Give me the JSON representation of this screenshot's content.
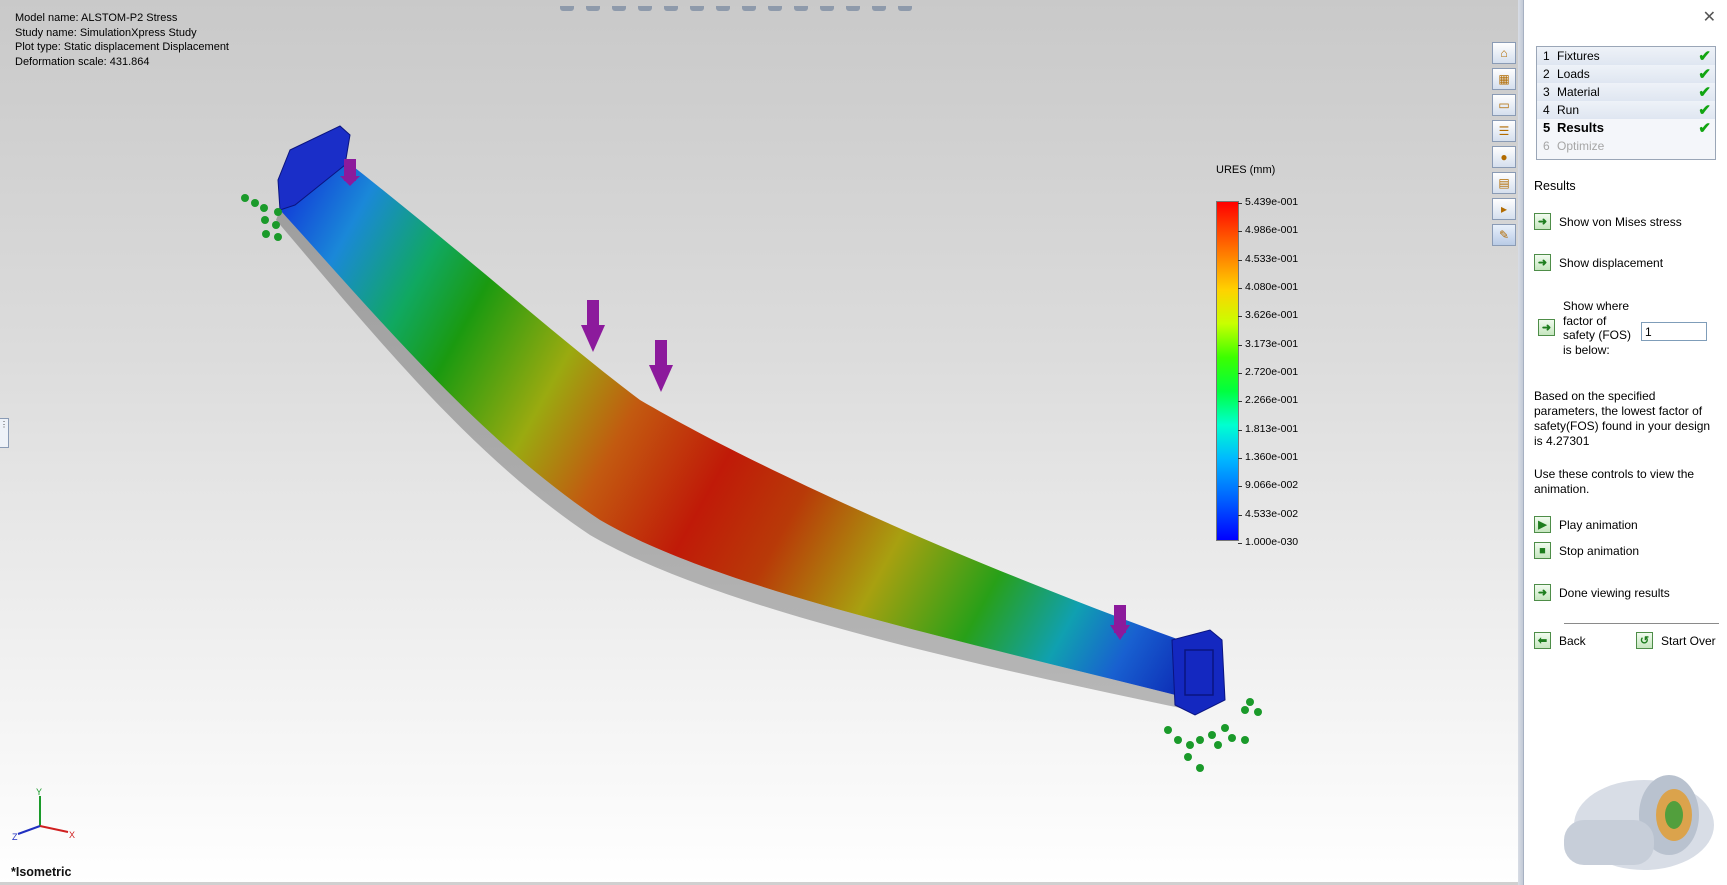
{
  "viewport": {
    "info": [
      "Model name: ALSTOM-P2 Stress",
      "Study name: SimulationXpress Study",
      "Plot type: Static displacement Displacement",
      "Deformation scale: 431.864"
    ],
    "legend": {
      "title": "URES (mm)",
      "ticks": [
        "5.439e-001",
        "4.986e-001",
        "4.533e-001",
        "4.080e-001",
        "3.626e-001",
        "3.173e-001",
        "2.720e-001",
        "2.266e-001",
        "1.813e-001",
        "1.360e-001",
        "9.066e-002",
        "4.533e-002",
        "1.000e-030"
      ]
    },
    "view_name": "*Isometric",
    "triad": {
      "x": "X",
      "y": "Y",
      "z": "Z"
    },
    "icon_strip": [
      "home-icon",
      "scene-icon",
      "folder-icon",
      "properties-icon",
      "appearance-icon",
      "custom-props-icon",
      "file-explorer-icon",
      "simulation-icon"
    ]
  },
  "pane": {
    "steps": [
      {
        "num": "1",
        "label": "Fixtures",
        "state": "done"
      },
      {
        "num": "2",
        "label": "Loads",
        "state": "done"
      },
      {
        "num": "3",
        "label": "Material",
        "state": "done"
      },
      {
        "num": "4",
        "label": "Run",
        "state": "done"
      },
      {
        "num": "5",
        "label": "Results",
        "state": "current"
      },
      {
        "num": "6",
        "label": "Optimize",
        "state": "disabled"
      }
    ],
    "results_heading": "Results",
    "show_von_mises": "Show von Mises stress",
    "show_displacement": "Show displacement",
    "fos_label": [
      "Show where",
      "factor of",
      "safety (FOS)",
      "is below:"
    ],
    "fos_value": "1",
    "fos_result": "Based on the specified parameters, the lowest factor of safety(FOS) found in your design is 4.27301",
    "anim_hint": "Use these controls to view the animation.",
    "play": "Play animation",
    "stop": "Stop animation",
    "done": "Done viewing results",
    "back": "Back",
    "start_over": "Start Over",
    "close_glyph": "✕",
    "check_glyph": "✔"
  },
  "colors": {
    "high": "#ff0000",
    "low": "#0000ff",
    "load_arrow": "#8c1a9c",
    "fixture": "#1a9a2a",
    "check": "#11a511"
  }
}
